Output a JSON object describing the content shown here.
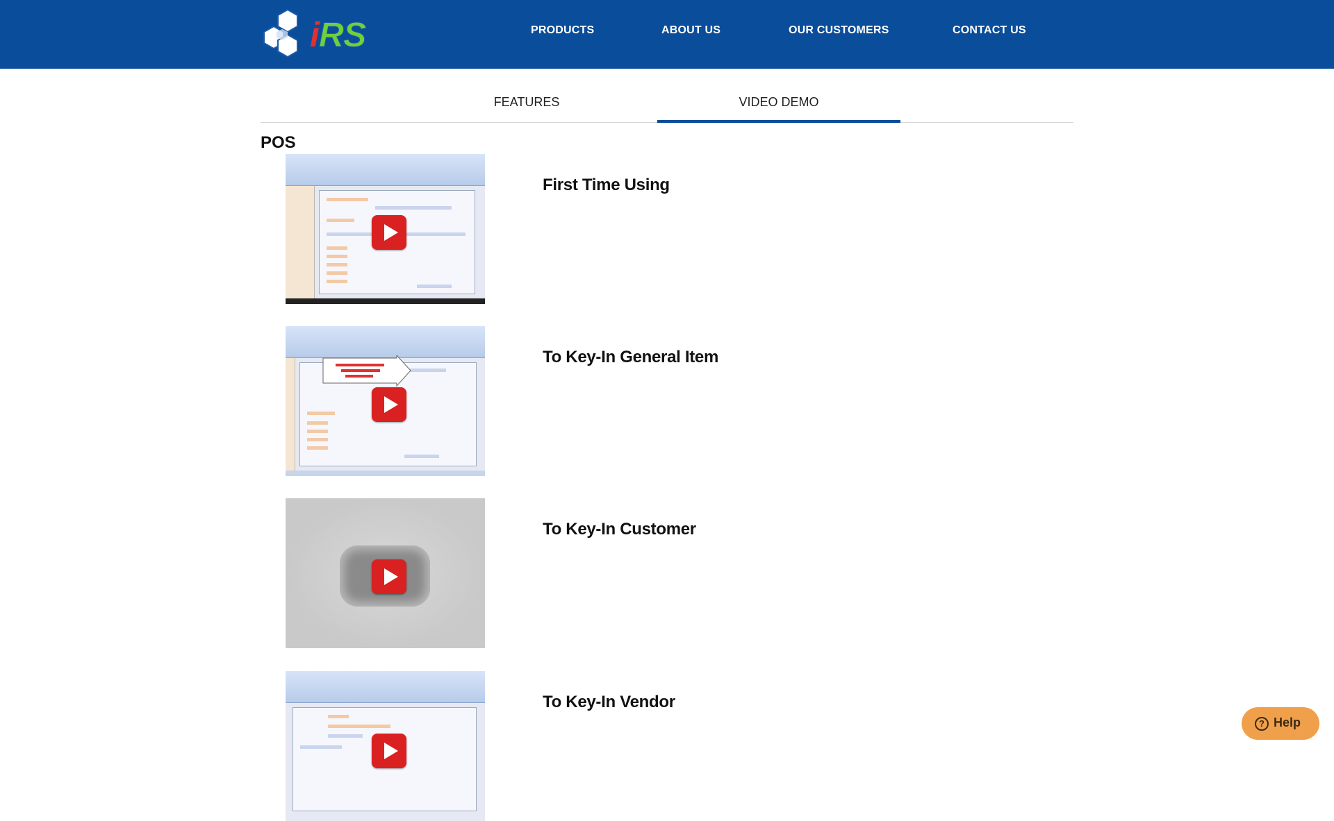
{
  "brand": {
    "logo_text_i": "i",
    "logo_text_rs": "RS",
    "colors": {
      "header_bg": "#0a4d9b",
      "accent": "#0a4d9b",
      "help_bg": "#f0a04b"
    }
  },
  "nav": {
    "items": [
      {
        "label": "PRODUCTS"
      },
      {
        "label": "ABOUT US"
      },
      {
        "label": "OUR CUSTOMERS"
      },
      {
        "label": "CONTACT US"
      }
    ]
  },
  "tabs": [
    {
      "label": "FEATURES",
      "active": false
    },
    {
      "label": "VIDEO DEMO",
      "active": true
    }
  ],
  "section": {
    "title": "POS"
  },
  "videos": [
    {
      "title": "First Time Using",
      "thumbnail": "pos-screen"
    },
    {
      "title": "To Key-In General Item",
      "thumbnail": "pos-screen-callout"
    },
    {
      "title": "To Key-In Customer",
      "thumbnail": "placeholder"
    },
    {
      "title": "To Key-In Vendor",
      "thumbnail": "pos-screen"
    }
  ],
  "help": {
    "label": "Help",
    "icon": "question-circle-icon"
  }
}
